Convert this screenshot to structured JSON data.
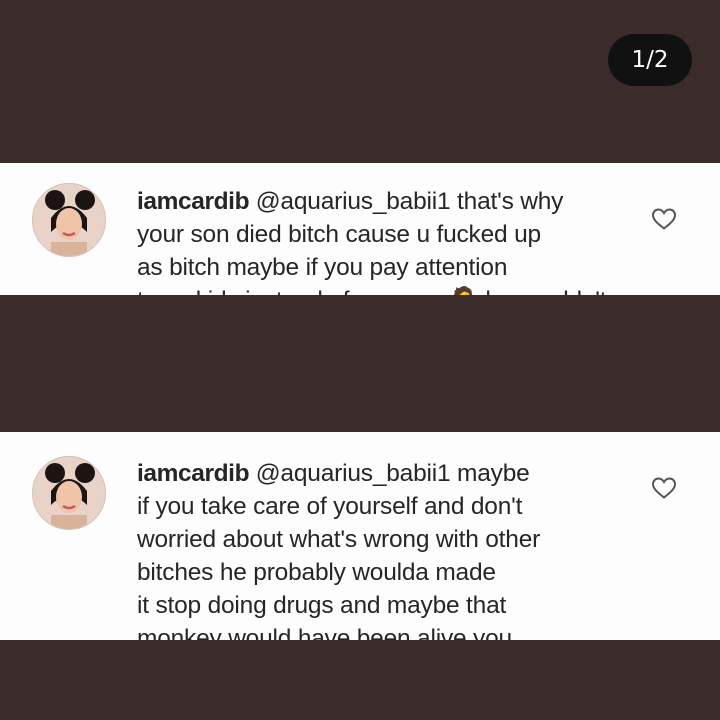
{
  "counter": "1/2",
  "comments": [
    {
      "username": "iamcardib",
      "mention": "@aquarius_babii1",
      "text_lines": [
        "that's why",
        "your son died bitch cause u fucked up",
        "as bitch maybe if you pay attention",
        "to ya kids instead of my man 🤷 he wouldn't"
      ],
      "heart_icon": "heart-outline-icon",
      "avatar_icon": "profile-avatar"
    },
    {
      "username": "iamcardib",
      "mention": "@aquarius_babii1",
      "text_lines": [
        "maybe",
        "if you take care of yourself and don't",
        "worried about what's wrong with other",
        "bitches he probably woulda made",
        "it stop doing drugs and maybe that",
        "monkey would have been alive you"
      ],
      "heart_icon": "heart-outline-icon",
      "avatar_icon": "profile-avatar"
    }
  ],
  "colors": {
    "background": "#3b2b2a",
    "card": "#fdfdfd",
    "text": "#262626",
    "counter_bg": "#111111"
  }
}
